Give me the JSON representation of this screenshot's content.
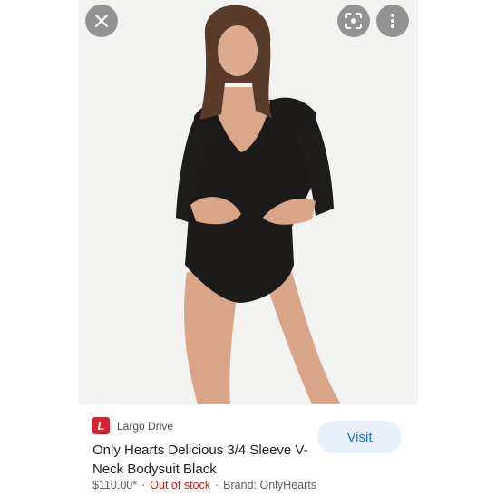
{
  "viewer": {
    "icons": {
      "close": "close-icon",
      "lens": "google-lens-icon",
      "more": "more-vertical-icon"
    }
  },
  "result": {
    "source": "Largo Drive",
    "favicon_letter": "L",
    "title": "Only Hearts Delicious 3/4 Sleeve V-Neck Bodysuit Black",
    "price": "$110.00*",
    "stock_status": "Out of stock",
    "brand": "Brand: OnlyHearts",
    "visit_label": "Visit"
  },
  "colors": {
    "favicon": "#d32230",
    "out_of_stock": "#c5221f",
    "visit_bg": "#e8f0fe",
    "visit_text": "#1a73e8"
  }
}
